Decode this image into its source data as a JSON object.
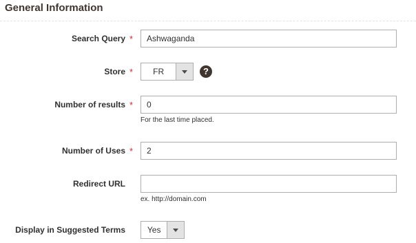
{
  "section": {
    "title": "General Information"
  },
  "fields": {
    "search_query": {
      "label": "Search Query",
      "required_mark": "*",
      "value": "Ashwaganda"
    },
    "store": {
      "label": "Store",
      "required_mark": "*",
      "selected": "FR",
      "help_glyph": "?"
    },
    "number_of_results": {
      "label": "Number of results",
      "required_mark": "*",
      "value": "0",
      "note": "For the last time placed."
    },
    "number_of_uses": {
      "label": "Number of Uses",
      "required_mark": "*",
      "value": "2"
    },
    "redirect_url": {
      "label": "Redirect URL",
      "value": "",
      "note": "ex. http://domain.com"
    },
    "display_in_suggested_terms": {
      "label": "Display in Suggested Terms",
      "selected": "Yes"
    }
  },
  "colors": {
    "required": "#e22626",
    "border": "#adadad",
    "select_arrow_bg": "#e3e3e3",
    "help_bg": "#41362f",
    "title": "#41362f"
  },
  "icons": {
    "select_arrow": "chevron-down-icon",
    "help": "help-icon"
  }
}
